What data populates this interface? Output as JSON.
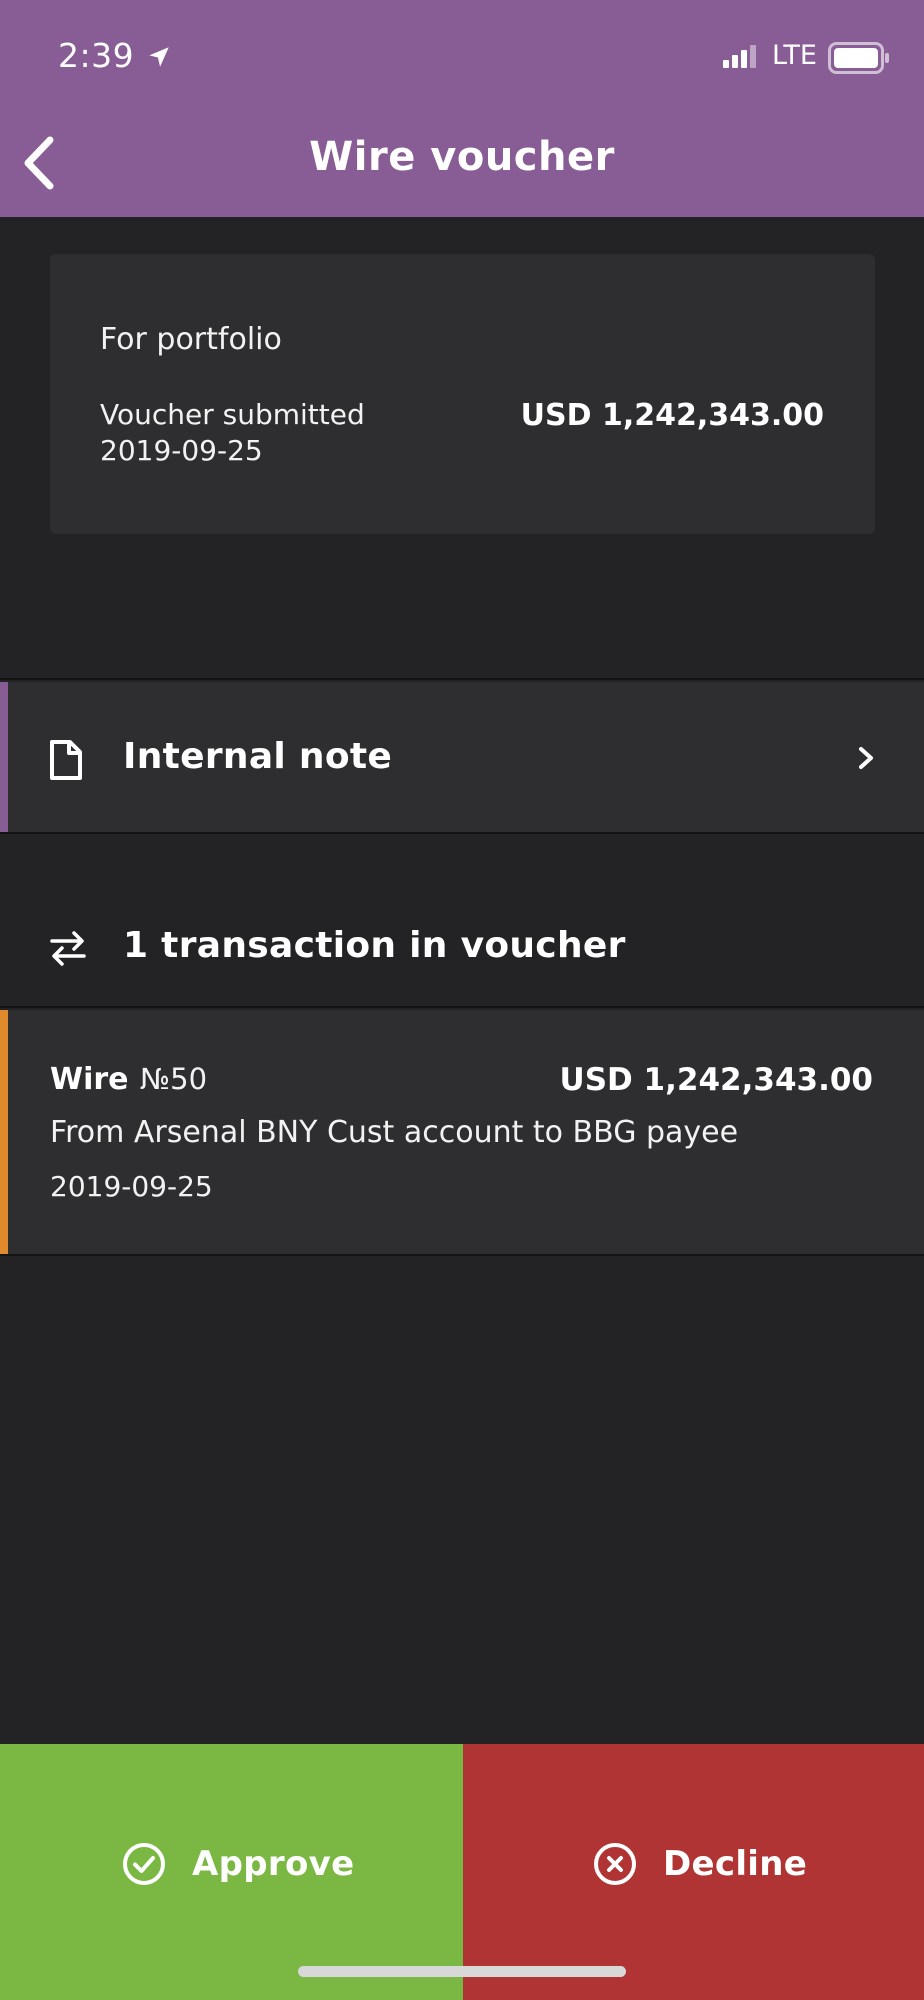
{
  "status_bar": {
    "time": "2:39",
    "network": "LTE"
  },
  "header": {
    "title": "Wire voucher"
  },
  "summary": {
    "portfolio_label": "For portfolio",
    "submitted_label": "Voucher submitted",
    "submitted_date": "2019-09-25",
    "amount": "USD 1,242,343.00"
  },
  "internal_note": {
    "label": "Internal note"
  },
  "transactions": {
    "count_label": "1 transaction in voucher",
    "items": [
      {
        "type": "Wire",
        "number": "№50",
        "amount": "USD 1,242,343.00",
        "description": "From Arsenal BNY Cust account to BBG payee",
        "date": "2019-09-25"
      }
    ]
  },
  "actions": {
    "approve_label": "Approve",
    "decline_label": "Decline"
  },
  "colors": {
    "header": "#885c95",
    "background": "#232325",
    "card": "#2e2e30",
    "note_accent": "#885c95",
    "transaction_accent": "#e08a2c",
    "approve": "#7bb843",
    "decline": "#b13434"
  },
  "icons": {
    "location": "location-arrow-icon",
    "signal": "cellular-signal-icon",
    "battery": "battery-icon",
    "back": "chevron-left-icon",
    "note": "document-icon",
    "note_chevron": "chevron-right-icon",
    "transactions": "swap-arrows-icon",
    "approve": "check-circle-icon",
    "decline": "x-circle-icon"
  }
}
